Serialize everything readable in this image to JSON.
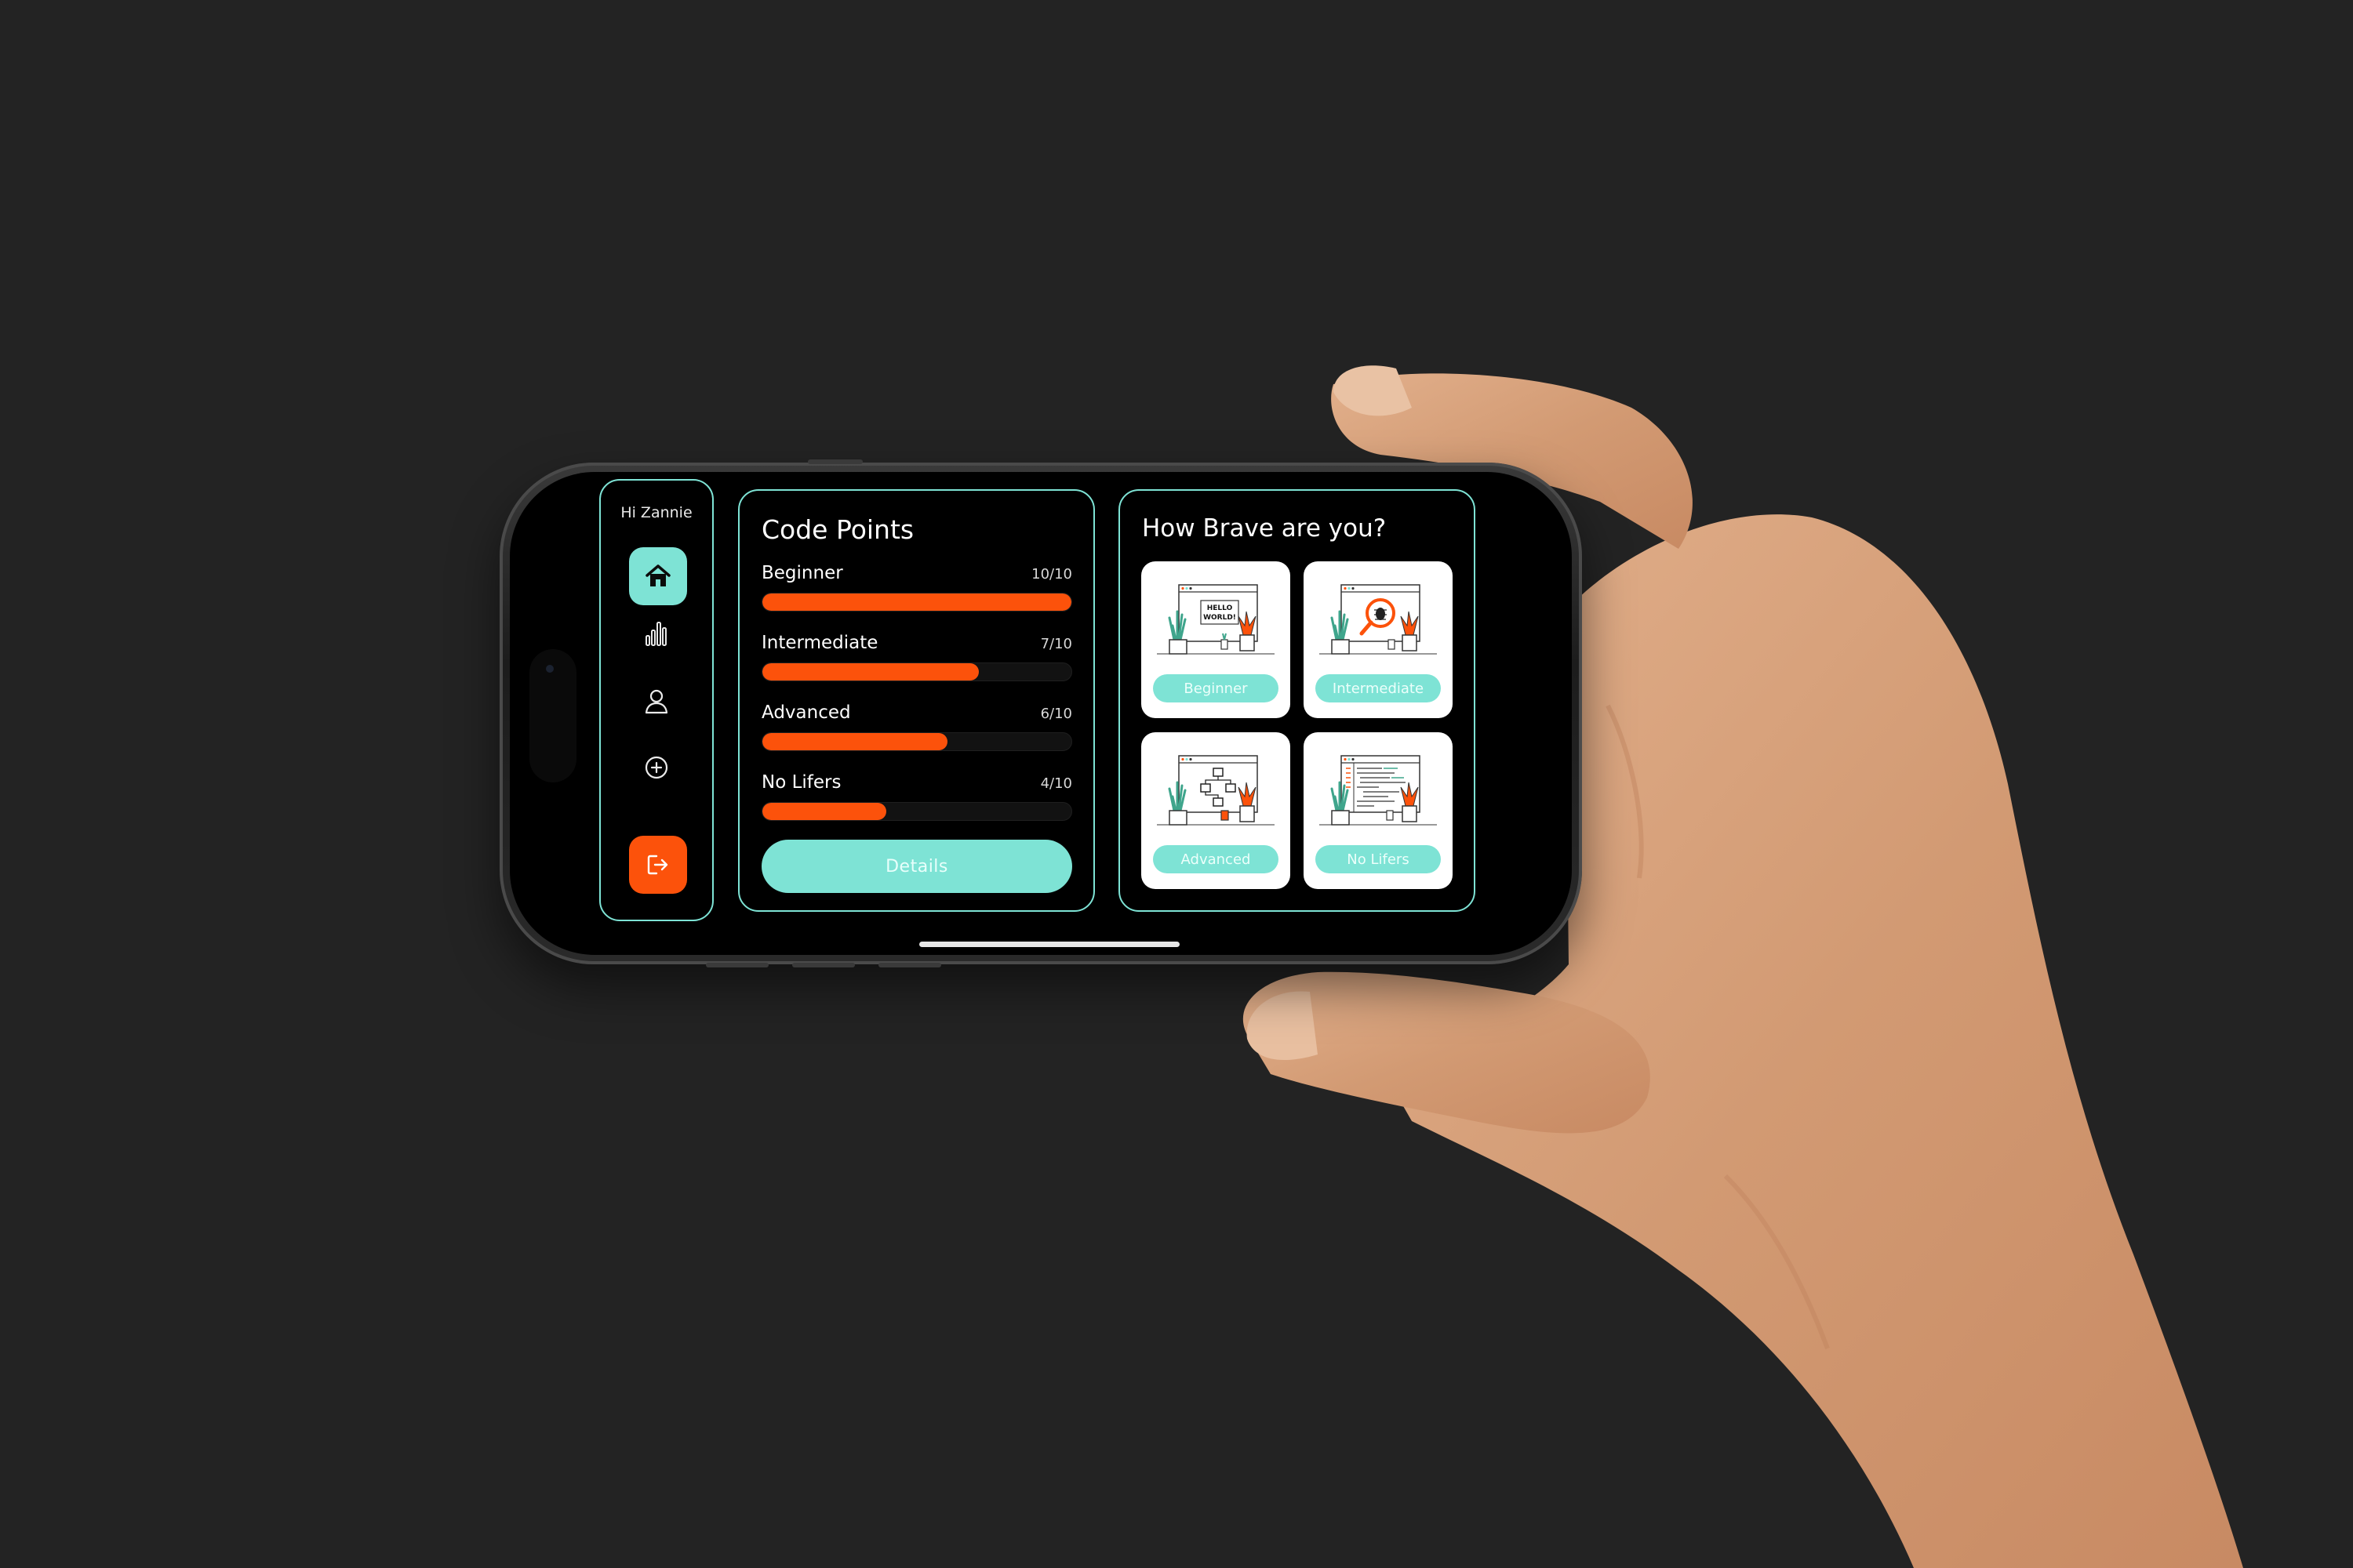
{
  "sidebar": {
    "greeting": "Hi Zannie",
    "items": [
      {
        "icon": "home-icon",
        "active": true
      },
      {
        "icon": "bar-chart-icon",
        "active": false
      },
      {
        "icon": "user-icon",
        "active": false
      },
      {
        "icon": "plus-circle-icon",
        "active": false
      },
      {
        "icon": "logout-icon",
        "active": false
      }
    ]
  },
  "code_points": {
    "title": "Code Points",
    "levels": [
      {
        "name": "Beginner",
        "score": "10/10",
        "progress": 1.0
      },
      {
        "name": "Intermediate",
        "score": "7/10",
        "progress": 0.7
      },
      {
        "name": "Advanced",
        "score": "6/10",
        "progress": 0.6
      },
      {
        "name": "No Lifers",
        "score": "4/10",
        "progress": 0.4
      }
    ],
    "details_label": "Details"
  },
  "brave": {
    "title": "How Brave are you?",
    "cards": [
      {
        "label": "Beginner",
        "illustration_text": [
          "HELLO",
          "WORLD!"
        ]
      },
      {
        "label": "Intermediate"
      },
      {
        "label": "Advanced"
      },
      {
        "label": "No Lifers"
      }
    ]
  },
  "colors": {
    "accent": "#7ee3d5",
    "orange": "#fc520b",
    "background": "#232323",
    "screen": "#000000"
  }
}
